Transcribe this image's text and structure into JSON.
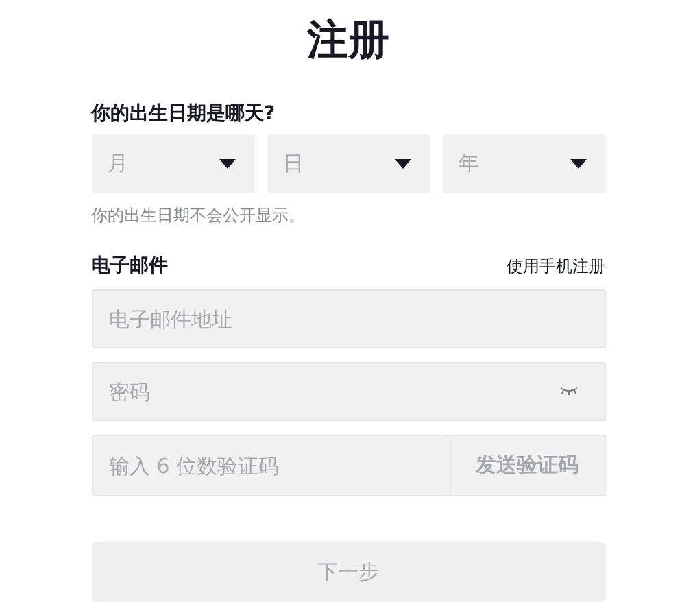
{
  "title": "注册",
  "birthday": {
    "label": "你的出生日期是哪天?",
    "selects": [
      {
        "placeholder": "月"
      },
      {
        "placeholder": "日"
      },
      {
        "placeholder": "年"
      }
    ],
    "hint": "你的出生日期不会公开显示。"
  },
  "email": {
    "label": "电子邮件",
    "switch_link": "使用手机注册",
    "address": {
      "placeholder": "电子邮件地址"
    },
    "password": {
      "placeholder": "密码"
    },
    "code": {
      "placeholder": "输入 6 位数验证码"
    },
    "send_code_button": "发送验证码"
  },
  "next_button": {
    "label": "下一步",
    "disabled": true
  }
}
